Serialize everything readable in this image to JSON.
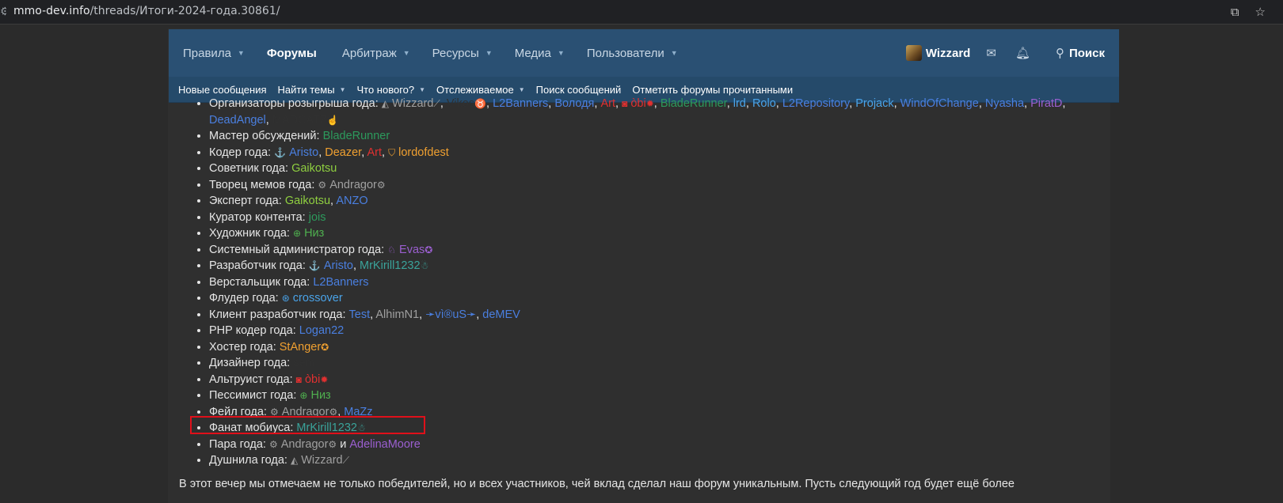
{
  "browser": {
    "url_domain": "mmo-dev.info",
    "url_path": "/threads/Итоги-2024-года.30861/"
  },
  "nav": {
    "items": [
      {
        "label": "Правила",
        "has_caret": true
      },
      {
        "label": "Форумы",
        "active": true
      },
      {
        "label": "Арбитраж",
        "has_caret": true
      },
      {
        "label": "Ресурсы",
        "has_caret": true
      },
      {
        "label": "Медиа",
        "has_caret": true
      },
      {
        "label": "Пользователи",
        "has_caret": true
      }
    ],
    "username": "Wizzard",
    "search_label": "Поиск",
    "sub_items": [
      {
        "label": "Новые сообщения"
      },
      {
        "label": "Найти темы",
        "has_caret": true
      },
      {
        "label": "Что нового?",
        "has_caret": true
      },
      {
        "label": "Отслеживаемое",
        "has_caret": true
      },
      {
        "label": "Поиск сообщений"
      },
      {
        "label": "Отметить форумы прочитанными"
      }
    ]
  },
  "awards": [
    {
      "title": "Организаторы розыгрыша года:",
      "users": [
        {
          "name": "Wizzard",
          "color": "#a0a0a0",
          "pre": "◭",
          "post": "⟋"
        },
        {
          "name": "Vikos",
          "color": "#303030",
          "post": "♉"
        },
        {
          "name": "L2Banners",
          "color": "#4a7fe0"
        },
        {
          "name": "Володя",
          "color": "#4a7fe0"
        },
        {
          "name": "Art",
          "color": "#e03030"
        },
        {
          "name": "òbi",
          "color": "#e03030",
          "pre": "◙",
          "post": "✹"
        },
        {
          "name": "BladeRunner",
          "color": "#2c9a5c"
        },
        {
          "name": "lrd",
          "color": "#4aa3e8"
        },
        {
          "name": "Rolo",
          "color": "#4aa3e8"
        },
        {
          "name": "L2Repository",
          "color": "#4a7fe0"
        },
        {
          "name": "Projack",
          "color": "#4aa3e8"
        },
        {
          "name": "WindOfChange",
          "color": "#4a7fe0"
        },
        {
          "name": "Nyasha",
          "color": "#4a7fe0"
        },
        {
          "name": "PiratD",
          "color": "#9b5fd0"
        },
        {
          "name": "DeadAngel",
          "color": "#4a7fe0"
        },
        {
          "name": "MADCATZ",
          "color": "#303030",
          "post": "☝"
        }
      ]
    },
    {
      "title": "Мастер обсуждений:",
      "users": [
        {
          "name": "BladeRunner",
          "color": "#2c9a5c"
        }
      ]
    },
    {
      "title": "Кодер года:",
      "users": [
        {
          "name": "Aristo",
          "color": "#4a7fe0",
          "pre": "⚓"
        },
        {
          "name": "Deazer",
          "color": "#f0a030"
        },
        {
          "name": "Art",
          "color": "#e03030"
        },
        {
          "name": "lordofdest",
          "color": "#f0a030",
          "pre": "⛉"
        }
      ]
    },
    {
      "title": "Советник года:",
      "users": [
        {
          "name": "Gaikotsu",
          "color": "#8fcf40"
        }
      ]
    },
    {
      "title": "Творец мемов года:",
      "users": [
        {
          "name": "Andragor",
          "color": "#a0a0a0",
          "pre": "⚙",
          "post": "⚙"
        }
      ]
    },
    {
      "title": "Эксперт года:",
      "users": [
        {
          "name": "Gaikotsu",
          "color": "#8fcf40"
        },
        {
          "name": "ANZO",
          "color": "#4a7fe0"
        }
      ]
    },
    {
      "title": "Куратор контента:",
      "users": [
        {
          "name": "jois",
          "color": "#2c9a5c"
        }
      ]
    },
    {
      "title": "Художник года:",
      "users": [
        {
          "name": "Низ",
          "color": "#4fb04f",
          "pre": "⊕"
        }
      ]
    },
    {
      "title": "Системный администратор года:",
      "users": [
        {
          "name": "Evas",
          "color": "#9b5fd0",
          "pre": "♘",
          "post": "✪"
        }
      ]
    },
    {
      "title": "Разработчик года:",
      "users": [
        {
          "name": "Aristo",
          "color": "#4a7fe0",
          "pre": "⚓"
        },
        {
          "name": "MrKirill1232",
          "color": "#3aa39a",
          "post": "☃"
        }
      ]
    },
    {
      "title": "Верстальщик года:",
      "users": [
        {
          "name": "L2Banners",
          "color": "#4a7fe0"
        }
      ]
    },
    {
      "title": "Флудер года:",
      "users": [
        {
          "name": "crossover",
          "color": "#4aa3e8",
          "pre": "⊛"
        }
      ]
    },
    {
      "title": "Клиент разработчик года:",
      "users": [
        {
          "name": "Test",
          "color": "#4a7fe0"
        },
        {
          "name": "AlhimN1",
          "color": "#a0a0a0"
        },
        {
          "name": "➛vì®uS➛",
          "color": "#4a7fe0"
        },
        {
          "name": "deMEV",
          "color": "#4a7fe0"
        }
      ]
    },
    {
      "title": "PHP кодер года:",
      "users": [
        {
          "name": "Logan22",
          "color": "#4a7fe0"
        }
      ]
    },
    {
      "title": "Хостер года:",
      "users": [
        {
          "name": "StAnger",
          "color": "#f0a030",
          "post": "✪"
        }
      ]
    },
    {
      "title": "Дизайнер года:",
      "users": [
        {
          "name": "sem",
          "color": "#303030"
        }
      ]
    },
    {
      "title": "Альтруист года:",
      "users": [
        {
          "name": "òbi",
          "color": "#e03030",
          "pre": "◙",
          "post": "✹"
        }
      ]
    },
    {
      "title": "Пессимист года:",
      "users": [
        {
          "name": "Низ",
          "color": "#4fb04f",
          "pre": "⊕"
        }
      ]
    },
    {
      "title": "Фейл года:",
      "users": [
        {
          "name": "Andragor",
          "color": "#a0a0a0",
          "pre": "⚙",
          "post": "⚙"
        },
        {
          "name": "MaZz",
          "color": "#4a7fe0"
        }
      ]
    },
    {
      "title": "Фанат мобиуса:",
      "users": [
        {
          "name": "MrKirill1232",
          "color": "#3aa39a",
          "post": "☃"
        }
      ]
    },
    {
      "title": "Пара года:",
      "users": [
        {
          "name": "Andragor",
          "color": "#a0a0a0",
          "pre": "⚙",
          "post": "⚙"
        },
        {
          "name": "AdelinaMoore",
          "color": "#9b5fd0"
        }
      ],
      "joiner": "и"
    },
    {
      "title": "Душнила года:",
      "users": [
        {
          "name": "Wizzard",
          "color": "#a0a0a0",
          "pre": "◭",
          "post": "⟋"
        }
      ]
    }
  ],
  "footer_text": "В этот вечер мы отмечаем не только победителей, но и всех участников, чей вклад сделал наш форум уникальным. Пусть следующий год будет ещё более"
}
